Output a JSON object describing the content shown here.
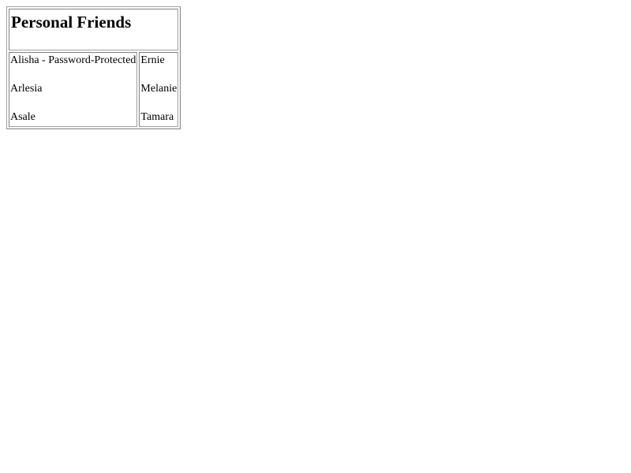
{
  "title": "Personal Friends",
  "columns": [
    {
      "items": [
        "Alisha - Password-Protected",
        "Arlesia",
        "Asale"
      ]
    },
    {
      "items": [
        "Ernie",
        "Melanie",
        "Tamara"
      ]
    }
  ]
}
